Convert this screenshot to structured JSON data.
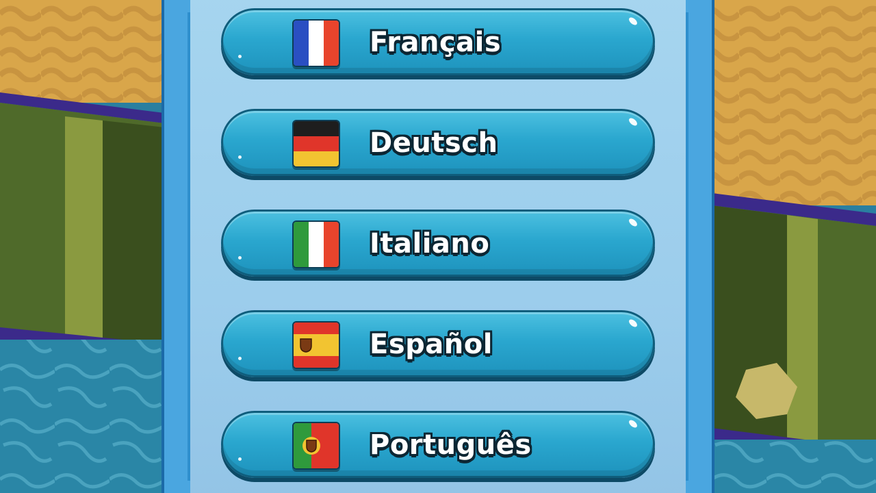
{
  "languages": [
    {
      "label": "Français",
      "flag": "france-flag-icon"
    },
    {
      "label": "Deutsch",
      "flag": "germany-flag-icon"
    },
    {
      "label": "Italiano",
      "flag": "italy-flag-icon"
    },
    {
      "label": "Español",
      "flag": "spain-flag-icon"
    },
    {
      "label": "Português",
      "flag": "portugal-flag-icon"
    }
  ],
  "colors": {
    "button": "#2aa7cf",
    "button_outline": "#0f5d7c",
    "panel": "#9fcfee",
    "panel_border": "#4aa6e0",
    "text_outline": "#0c2633"
  }
}
